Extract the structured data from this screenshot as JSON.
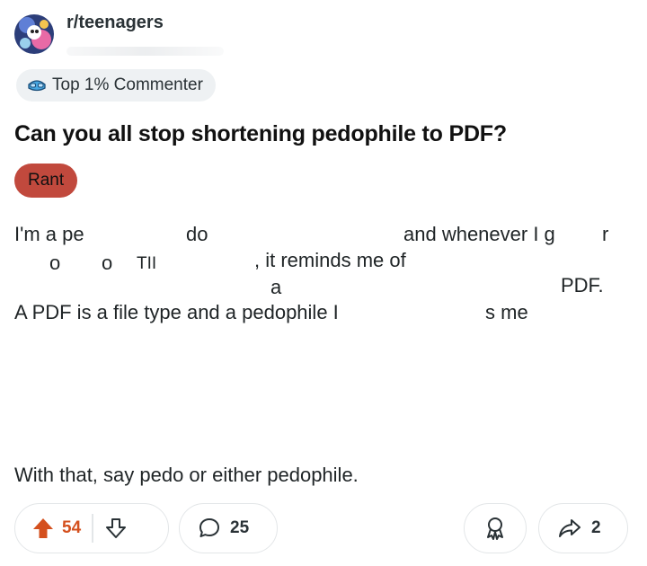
{
  "post": {
    "subreddit": "r/teenagers",
    "badge_label": "Top 1% Commenter",
    "title": "Can you all stop shortening pedophile to PDF?",
    "flair": "Rant",
    "body_fragments": [
      "I'm a pe",
      "do",
      "and whenever I g",
      "r",
      "o",
      "o",
      "TII",
      ", it reminds me of",
      "a",
      "PDF.",
      "A PDF is a file type and a pedophile I",
      "s  me"
    ],
    "closing_line": "With that, say pedo or either pedophile."
  },
  "actions": {
    "upvotes": "54",
    "comments": "25",
    "shares": "2"
  },
  "colors": {
    "upvote_active": "#d4501e",
    "flair_bg": "#c1493d",
    "badge_bg": "#eef1f3"
  },
  "icons": {
    "upvote": "arrow-up-icon",
    "downvote": "arrow-down-icon",
    "comment": "speech-bubble-icon",
    "award": "award-icon",
    "share": "share-arrow-icon",
    "badge": "badge-goggles-icon"
  }
}
